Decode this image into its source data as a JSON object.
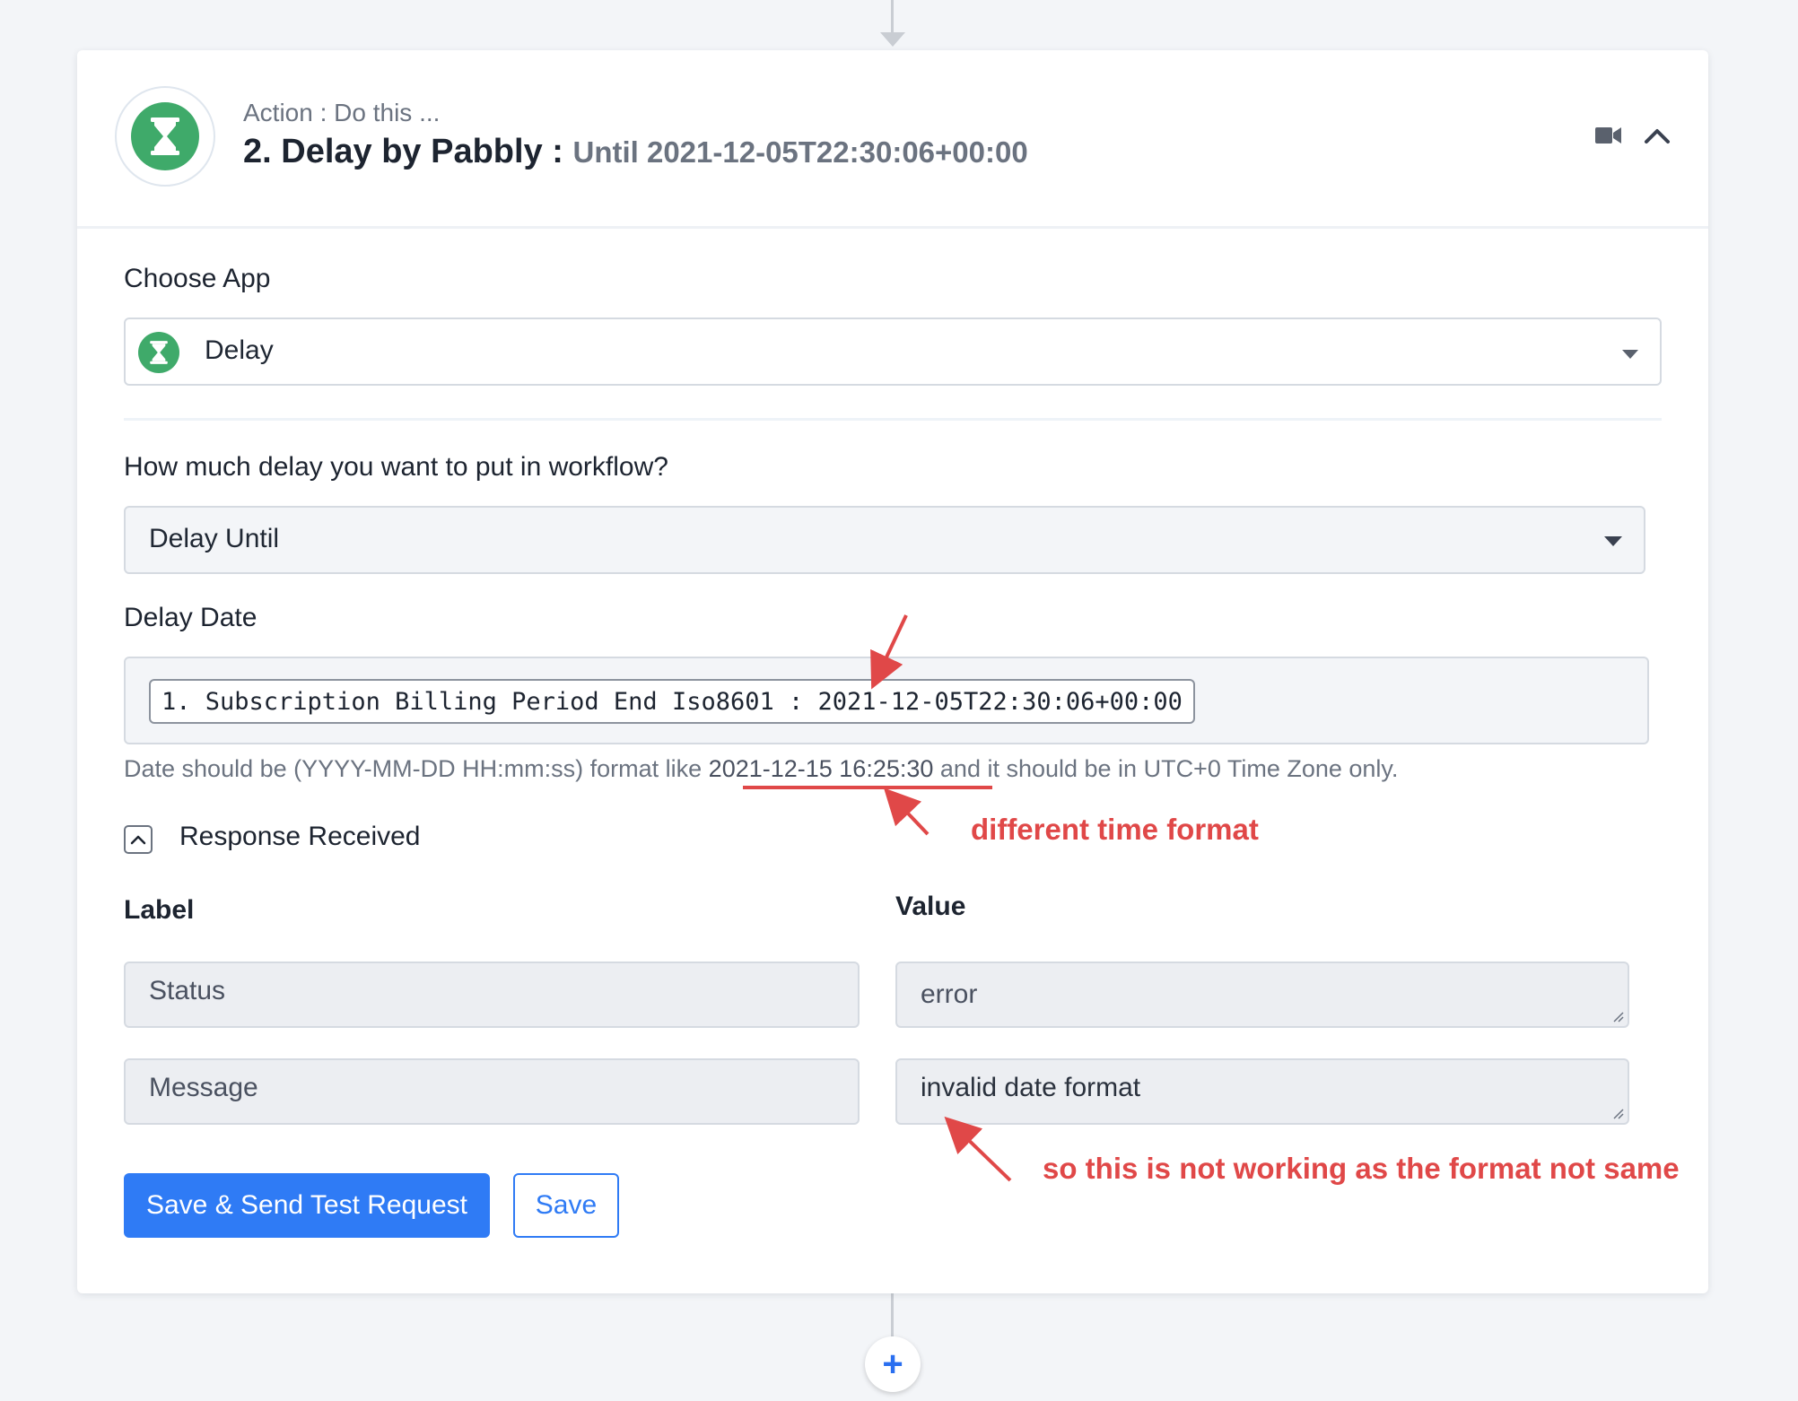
{
  "header": {
    "subtitle": "Action : Do this ...",
    "title": "2. Delay by Pabbly :",
    "title_suffix": "Until 2021-12-05T22:30:06+00:00"
  },
  "choose_app": {
    "label": "Choose App",
    "selected": "Delay"
  },
  "delay": {
    "question": "How much delay you want to put in workflow?",
    "selected": "Delay Until"
  },
  "delay_date": {
    "label": "Delay Date",
    "chip": "1. Subscription Billing Period End Iso8601 : 2021-12-05T22:30:06+00:00",
    "hint_prefix": "Date should be (YYYY-MM-DD HH:mm:ss) format like",
    "hint_example": "2021-12-15 16:25:30",
    "hint_suffix": "and it should be in UTC+0 Time Zone only."
  },
  "response": {
    "toggle_label": "Response Received",
    "label_header": "Label",
    "value_header": "Value",
    "rows": [
      {
        "label": "Status",
        "value": "error"
      },
      {
        "label": "Message",
        "value": "invalid date format"
      }
    ]
  },
  "buttons": {
    "save_send": "Save & Send Test Request",
    "save": "Save"
  },
  "annotations": {
    "time_format": "different time format",
    "not_working": "so this is not working as the format not same",
    "color": "#e04848"
  },
  "colors": {
    "accent": "#2f7bf5",
    "app_icon": "#3faa6a"
  }
}
